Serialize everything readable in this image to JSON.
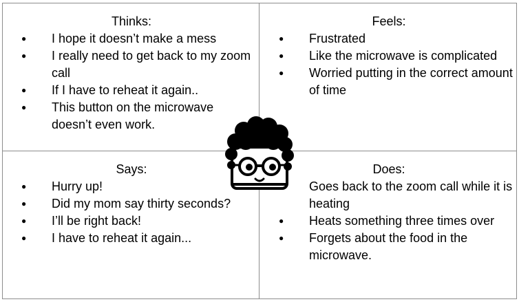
{
  "quadrants": {
    "thinks": {
      "title": "Thinks:",
      "items": [
        "I hope it doesn’t make a mess",
        "I really need to get back to my zoom call",
        "If I have to reheat it again..",
        "This button on the microwave doesn’t even work."
      ]
    },
    "feels": {
      "title": "Feels:",
      "items": [
        "Frustrated",
        "Like the microwave is complicated",
        "Worried putting in the correct amount of time"
      ]
    },
    "says": {
      "title": "Says:",
      "items": [
        "Hurry up!",
        "Did my mom say thirty seconds?",
        "I’ll be right back!",
        "I have to reheat it again..."
      ]
    },
    "does": {
      "title": "Does:",
      "items": [
        "Goes back to the zoom call while it is heating",
        "Heats something three times over",
        "Forgets about the food in the microwave."
      ]
    }
  },
  "avatar": {
    "icon": "curly-hair-glasses-face-icon"
  }
}
